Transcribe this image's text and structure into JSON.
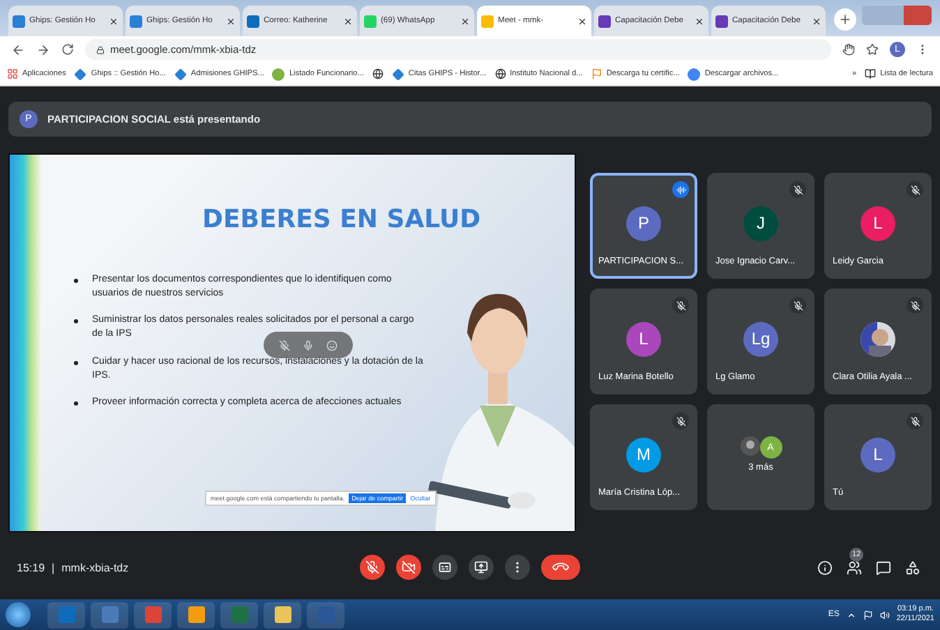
{
  "tabs": [
    {
      "label": "Ghips: Gestión Ho",
      "selected": false,
      "kind": "diamond"
    },
    {
      "label": "Ghips: Gestión Ho",
      "selected": false,
      "kind": "diamond"
    },
    {
      "label": "Correo: Katherine",
      "selected": false,
      "kind": "outlook"
    },
    {
      "label": "(69) WhatsApp",
      "selected": false,
      "kind": "whatsapp"
    },
    {
      "label": "Meet - mmk-",
      "selected": true,
      "kind": "meet"
    },
    {
      "label": "Capacitación Debe",
      "selected": false,
      "kind": "forms"
    },
    {
      "label": "Capacitación Debe",
      "selected": false,
      "kind": "forms"
    }
  ],
  "address": "meet.google.com/mmk-xbia-tdz",
  "profile_initial": "L",
  "bookmarks": [
    {
      "label": "Aplicaciones",
      "kind": "apps"
    },
    {
      "label": "Ghips :: Gestión Ho...",
      "kind": "diamond"
    },
    {
      "label": "Admisiones GHIPS...",
      "kind": "diamond"
    },
    {
      "label": "Listado Funcionario...",
      "kind": "dot"
    },
    {
      "kind": "globe"
    },
    {
      "label": "Citas GHIPS - Histor...",
      "kind": "diamond"
    },
    {
      "label": "Instituto Nacional d...",
      "kind": "globe"
    },
    {
      "label": "Descarga tu certific...",
      "kind": "flag"
    },
    {
      "label": "Descargar archivos...",
      "kind": "google"
    }
  ],
  "bookmarks_more": "»",
  "reading_list": "Lista de lectura",
  "banner": {
    "initial": "P",
    "text": "PARTICIPACION SOCIAL está presentando"
  },
  "slide": {
    "title": "DEBERES EN SALUD",
    "bullets": [
      "Presentar los documentos correspondientes que lo identifiquen como usuarios de nuestros servicios",
      "Suministrar los datos personales reales solicitados por el personal a cargo de la IPS",
      "Cuidar y hacer uso racional de los recursos, instalaciones y la dotación de la IPS.",
      "Proveer información correcta y completa acerca de afecciones actuales"
    ],
    "share_notice": {
      "text": "meet.google.com está compartiendo tu pantalla.",
      "stop": "Dejar de compartir",
      "hide": "Ocultar"
    }
  },
  "tiles": [
    {
      "name": "PARTICIPACION S...",
      "initial": "P",
      "color": "#5c6bc0",
      "kind": "avatar",
      "speaking": true,
      "muted": false
    },
    {
      "name": "Jose Ignacio Carv...",
      "initial": "J",
      "color": "#004d40",
      "kind": "avatar",
      "speaking": false,
      "muted": true
    },
    {
      "name": "Leidy Garcia",
      "initial": "L",
      "color": "#e91e63",
      "kind": "avatar",
      "speaking": false,
      "muted": true
    },
    {
      "name": "Luz Marina Botello",
      "initial": "L",
      "color": "#ab47bc",
      "kind": "avatar",
      "speaking": false,
      "muted": true
    },
    {
      "name": "Lg Glamo",
      "initial": "Lg",
      "color": "#5c6bc0",
      "kind": "avatar",
      "speaking": false,
      "muted": true
    },
    {
      "name": "Clara Otilia Ayala ...",
      "color": "#3949ab",
      "speaking": false,
      "muted": true
    },
    {
      "name": "María Cristina Lóp...",
      "initial": "M",
      "color": "#039be5",
      "kind": "avatar",
      "speaking": false,
      "muted": true
    },
    {
      "name": "3 más",
      "initial": "A",
      "color": "#7cb342",
      "kind": "more",
      "speaking": false,
      "muted": false
    },
    {
      "name": "Tú",
      "initial": "L",
      "color": "#5c6bc0",
      "kind": "avatar",
      "speaking": false,
      "muted": true
    }
  ],
  "meeting": {
    "time": "15:19",
    "separator": "|",
    "code": "mmk-xbia-tdz",
    "participants_count": "12"
  },
  "controls": [
    {
      "kind": "mic",
      "off": true
    },
    {
      "kind": "camera",
      "off": true
    },
    {
      "kind": "captions",
      "off": false
    },
    {
      "kind": "present",
      "off": false
    },
    {
      "kind": "more",
      "off": false
    },
    {
      "kind": "hangup",
      "off": true
    }
  ],
  "taskbar": {
    "apps": [
      {
        "kind": "outlook"
      },
      {
        "kind": "network"
      },
      {
        "kind": "chrome"
      },
      {
        "kind": "fire"
      },
      {
        "kind": "excel"
      },
      {
        "kind": "folder"
      },
      {
        "kind": "word"
      }
    ],
    "language": "ES",
    "time": "03:19 p.m.",
    "date": "22/11/2021"
  }
}
